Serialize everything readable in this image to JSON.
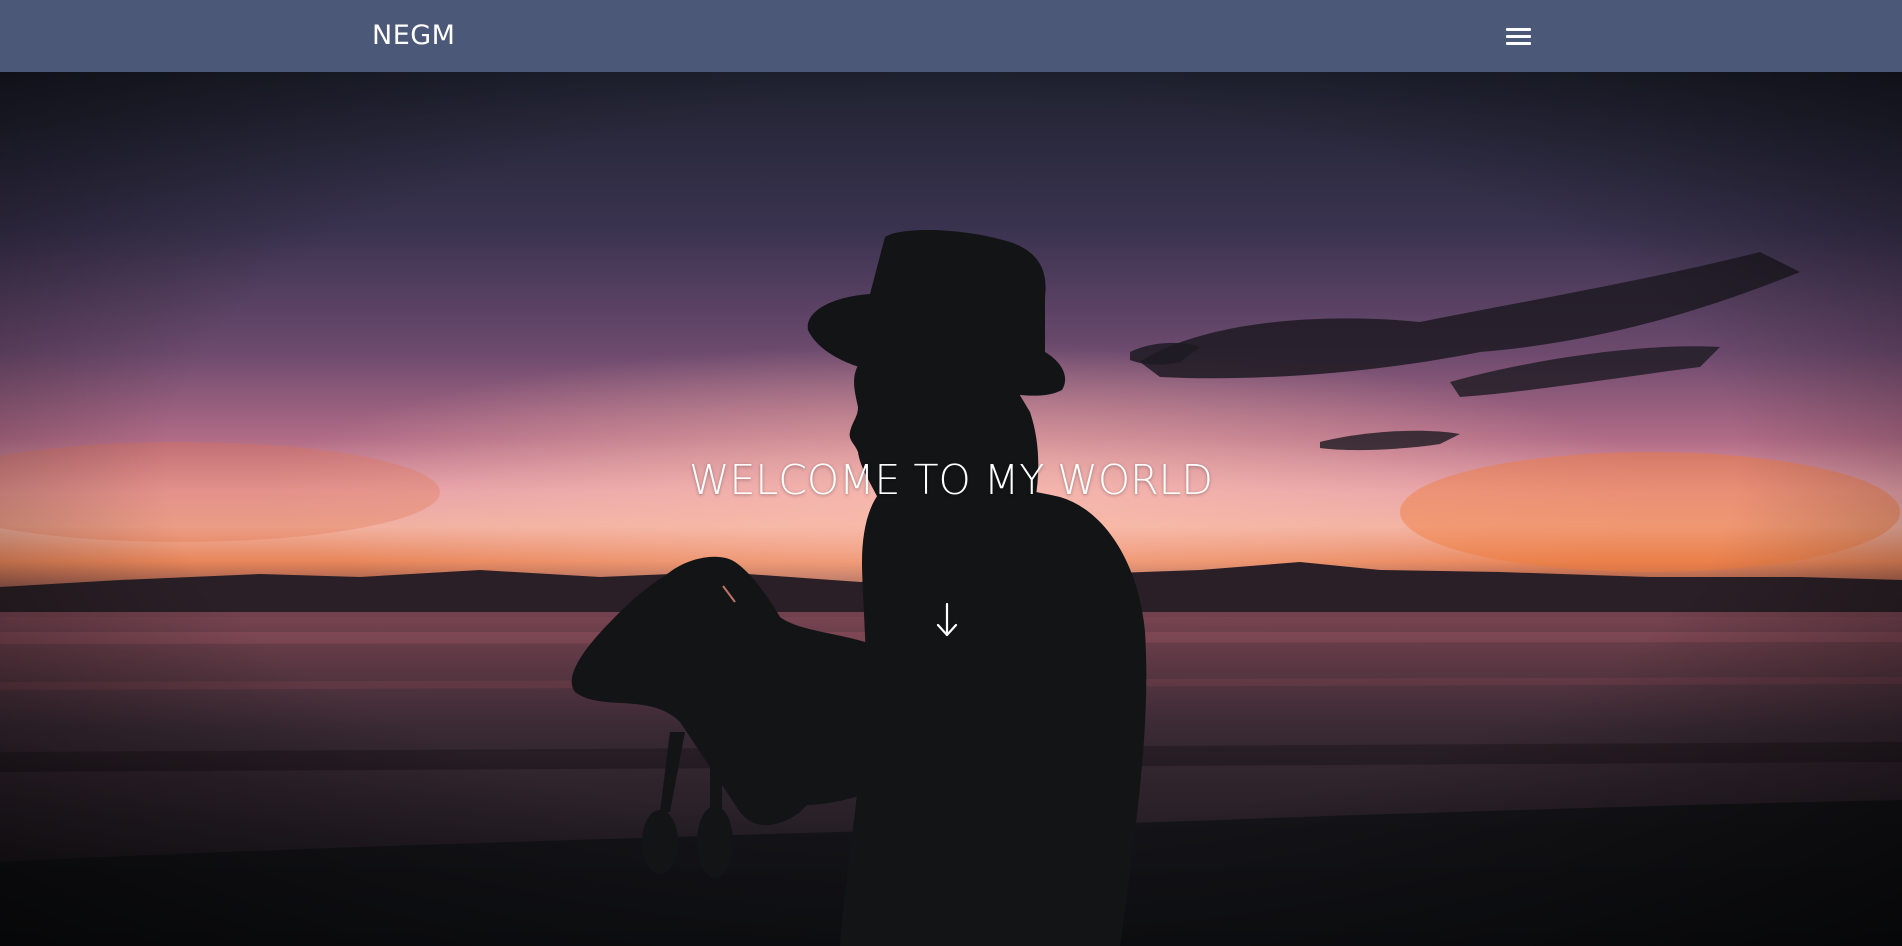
{
  "navbar": {
    "brand": "NEGM",
    "menu_icon": "hamburger-menu-icon",
    "background": "#4b5878"
  },
  "hero": {
    "title": "WELCOME TO MY WORLD",
    "scroll_icon": "arrow-down-icon",
    "background_description_colors": {
      "sky_top": "#2a2438",
      "sky_glow": "#e08a9a",
      "horizon_orange": "#f08a4a",
      "silhouette": "#141517"
    }
  }
}
